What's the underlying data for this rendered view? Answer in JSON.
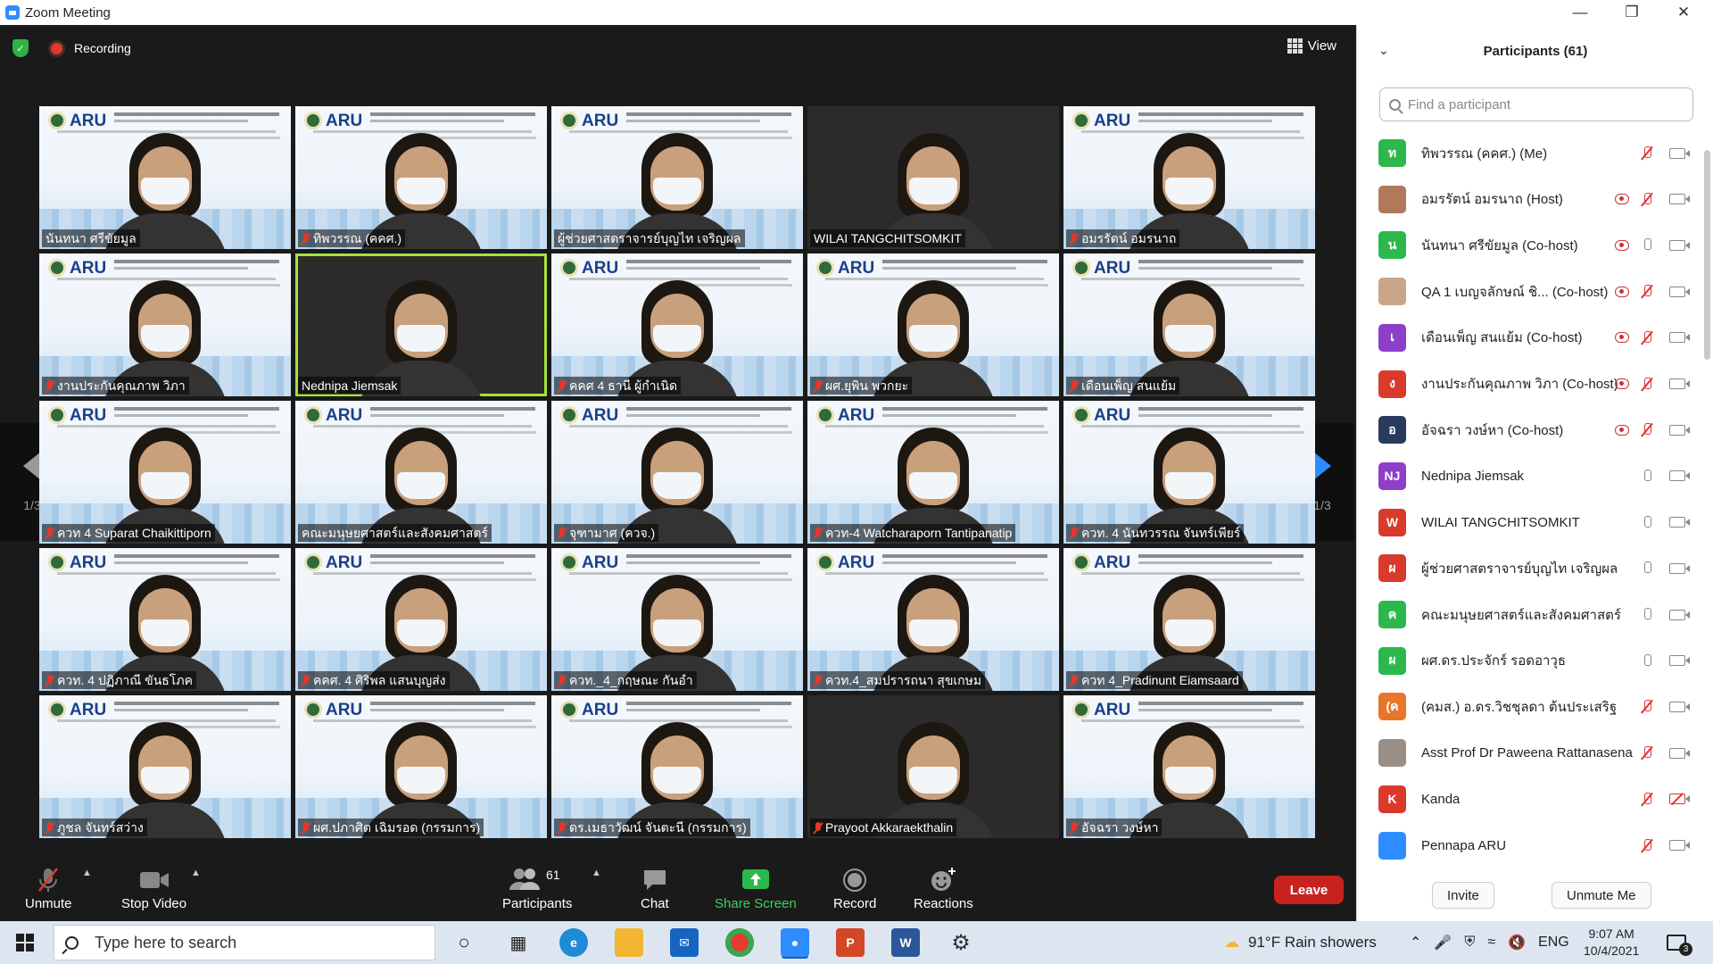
{
  "window": {
    "title": "Zoom Meeting"
  },
  "meeting": {
    "recording_label": "Recording",
    "view_label": "View",
    "page_indicator": "1/3",
    "tiles": [
      {
        "name": "นันทนา ศรีขัยมูล",
        "kind": "slide",
        "muted": false
      },
      {
        "name": "ทิพวรรณ (คคศ.)",
        "kind": "slide",
        "muted": true
      },
      {
        "name": "ผู้ช่วยศาสตราจารย์บุญไท เจริญผล",
        "kind": "slide",
        "muted": false
      },
      {
        "name": "WILAI TANGCHITSOMKIT",
        "kind": "cam",
        "muted": false
      },
      {
        "name": "อมรรัตน์ อมรนาถ",
        "kind": "slide",
        "muted": true
      },
      {
        "name": "งานประกันคุณภาพ วิภา",
        "kind": "slide",
        "muted": true
      },
      {
        "name": "Nednipa Jiemsak",
        "kind": "cam",
        "muted": false,
        "active": true
      },
      {
        "name": "คคศ 4 ธานี ผู้กำเนิด",
        "kind": "slide",
        "muted": true
      },
      {
        "name": "ผศ.ยุพิน พวกยะ",
        "kind": "slide",
        "muted": true
      },
      {
        "name": "เดือนเพ็ญ สนแย้ม",
        "kind": "slide",
        "muted": true
      },
      {
        "name": "ควท 4 Suparat Chaikittiporn",
        "kind": "slide",
        "muted": true
      },
      {
        "name": "คณะมนุษยศาสตร์และสังคมศาสตร์",
        "kind": "slide",
        "muted": false
      },
      {
        "name": "จุฑามาศ (ควจ.)",
        "kind": "slide",
        "muted": true
      },
      {
        "name": "ควท-4 Watcharaporn Tantipanatip",
        "kind": "slide",
        "muted": true
      },
      {
        "name": "ควท. 4 นันทวรรณ จันทร์เพียร์",
        "kind": "slide",
        "muted": true
      },
      {
        "name": "ควท. 4 ปฏิภาณี ขันธโภค",
        "kind": "slide",
        "muted": true
      },
      {
        "name": "คคศ. 4 ศิริพล แสนบุญส่ง",
        "kind": "slide",
        "muted": true
      },
      {
        "name": "ควท._4_กฤษณะ กันอำ",
        "kind": "slide",
        "muted": true
      },
      {
        "name": "ควท.4_สมปรารถนา สุขเกษม",
        "kind": "slide",
        "muted": true
      },
      {
        "name": "ควท 4_Pradinunt Eiamsaard",
        "kind": "slide",
        "muted": true
      },
      {
        "name": "ภูชล จันทร์สว่าง",
        "kind": "slide",
        "muted": true
      },
      {
        "name": "ผศ.ปภาศิต เฉิมรอด (กรรมการ)",
        "kind": "slide",
        "muted": true
      },
      {
        "name": "ดร.เมธาวัฒน์ จันตะนี (กรรมการ)",
        "kind": "slide",
        "muted": true
      },
      {
        "name": "Prayoot Akkaraekthalin",
        "kind": "cam",
        "muted": true
      },
      {
        "name": "อัจฉรา วงษ์หา",
        "kind": "slide",
        "muted": true
      }
    ]
  },
  "toolbar": {
    "unmute": "Unmute",
    "stop_video": "Stop Video",
    "participants": "Participants",
    "participants_count": "61",
    "chat": "Chat",
    "share_screen": "Share Screen",
    "record": "Record",
    "reactions": "Reactions",
    "leave": "Leave"
  },
  "panel": {
    "title": "Participants (61)",
    "search_placeholder": "Find a participant",
    "invite": "Invite",
    "unmute_me": "Unmute Me",
    "participants": [
      {
        "initial": "ท",
        "color": "#2db84d",
        "name": "ทิพวรรณ (คคศ.) (Me)",
        "rec": false,
        "mic": "off",
        "video": "on"
      },
      {
        "initial": "",
        "color": "#b07a5a",
        "name": "อมรรัตน์ อมรนาถ (Host)",
        "rec": true,
        "mic": "off",
        "video": "on"
      },
      {
        "initial": "น",
        "color": "#2db84d",
        "name": "นันทนา ศรีขัยมูล (Co-host)",
        "rec": true,
        "mic": "on",
        "video": "on"
      },
      {
        "initial": "",
        "color": "#c9a58a",
        "name": "QA 1 เบญจลักษณ์ ชิ... (Co-host)",
        "rec": true,
        "mic": "off",
        "video": "on"
      },
      {
        "initial": "เ",
        "color": "#8e3fc7",
        "name": "เดือนเพ็ญ สนแย้ม (Co-host)",
        "rec": true,
        "mic": "off",
        "video": "on"
      },
      {
        "initial": "ง",
        "color": "#d93a2b",
        "name": "งานประกันคุณภาพ วิภา (Co-host)",
        "rec": true,
        "mic": "off",
        "video": "on"
      },
      {
        "initial": "อ",
        "color": "#2a3a5c",
        "name": "อัจฉรา วงษ์หา (Co-host)",
        "rec": true,
        "mic": "off",
        "video": "on"
      },
      {
        "initial": "NJ",
        "color": "#8e3fc7",
        "name": "Nednipa Jiemsak",
        "rec": false,
        "mic": "on",
        "video": "on"
      },
      {
        "initial": "W",
        "color": "#d93a2b",
        "name": "WILAI TANGCHITSOMKIT",
        "rec": false,
        "mic": "on",
        "video": "on"
      },
      {
        "initial": "ผ",
        "color": "#d93a2b",
        "name": "ผู้ช่วยศาสตราจารย์บุญไท เจริญผล",
        "rec": false,
        "mic": "on",
        "video": "on"
      },
      {
        "initial": "ค",
        "color": "#2db84d",
        "name": "คณะมนุษยศาสตร์และสังคมศาสตร์",
        "rec": false,
        "mic": "on",
        "video": "on"
      },
      {
        "initial": "ผ",
        "color": "#2db84d",
        "name": "ผศ.ดร.ประจักร์ รอดอาวุธ",
        "rec": false,
        "mic": "on",
        "video": "on"
      },
      {
        "initial": "(ค",
        "color": "#e8762a",
        "name": "(คมส.) อ.ดร.วิชชุลดา ต้นประเสริฐ",
        "rec": false,
        "mic": "off",
        "video": "on"
      },
      {
        "initial": "",
        "color": "#9a8f86",
        "name": "Asst Prof Dr Paweena Rattanasena",
        "rec": false,
        "mic": "off",
        "video": "on"
      },
      {
        "initial": "K",
        "color": "#d93a2b",
        "name": "Kanda",
        "rec": false,
        "mic": "off",
        "video": "off"
      },
      {
        "initial": "",
        "color": "#2d8cff",
        "name": "Pennapa ARU",
        "rec": false,
        "mic": "off",
        "video": "on"
      }
    ]
  },
  "taskbar": {
    "search_placeholder": "Type here to search",
    "weather": "91°F  Rain showers",
    "lang": "ENG",
    "time": "9:07 AM",
    "date": "10/4/2021",
    "notif_count": "3"
  }
}
